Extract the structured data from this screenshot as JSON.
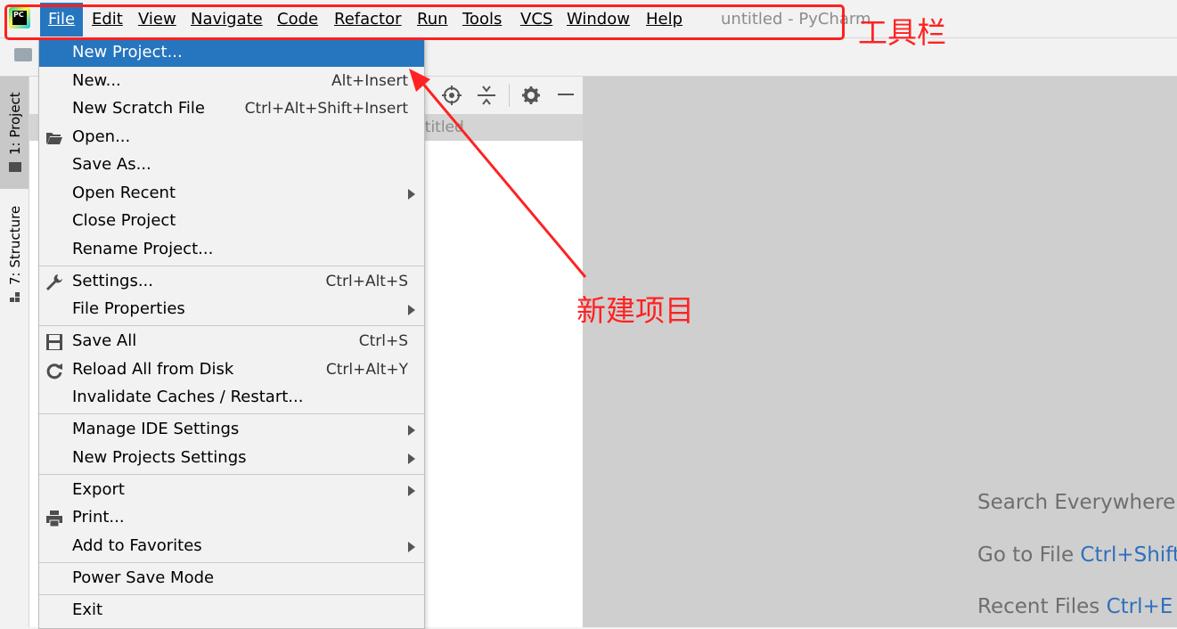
{
  "app": {
    "logo_text": "PC",
    "window_title": "untitled - PyCharm"
  },
  "menubar": {
    "items": [
      {
        "label": "File",
        "underline": 0
      },
      {
        "label": "Edit",
        "underline": 0
      },
      {
        "label": "View",
        "underline": 0
      },
      {
        "label": "Navigate",
        "underline": 0
      },
      {
        "label": "Code",
        "underline": 0
      },
      {
        "label": "Refactor",
        "underline": 0
      },
      {
        "label": "Run",
        "underline": 0
      },
      {
        "label": "Tools",
        "underline": 0
      },
      {
        "label": "VCS",
        "underline": 0
      },
      {
        "label": "Window",
        "underline": 0
      },
      {
        "label": "Help",
        "underline": 0
      }
    ]
  },
  "annotations": {
    "toolbar_label": "工具栏",
    "new_project_label": "新建项目",
    "color": "#ff2222"
  },
  "left_strip": {
    "project_tab": "1: Project",
    "structure_tab": "7: Structure"
  },
  "project_pane": {
    "row_text": "ntitled"
  },
  "file_menu": {
    "items": [
      {
        "label": "New Project...",
        "shortcut": "",
        "submenu": false
      },
      {
        "label": "New...",
        "shortcut": "Alt+Insert",
        "submenu": false
      },
      {
        "label": "New Scratch File",
        "shortcut": "Ctrl+Alt+Shift+Insert",
        "submenu": false
      },
      {
        "label": "Open...",
        "shortcut": "",
        "submenu": false,
        "icon": "folder-open-icon"
      },
      {
        "label": "Save As...",
        "shortcut": "",
        "submenu": false
      },
      {
        "label": "Open Recent",
        "shortcut": "",
        "submenu": true
      },
      {
        "label": "Close Project",
        "shortcut": "",
        "submenu": false
      },
      {
        "label": "Rename Project...",
        "shortcut": "",
        "submenu": false
      },
      {
        "label": "Settings...",
        "shortcut": "Ctrl+Alt+S",
        "submenu": false,
        "icon": "wrench-icon"
      },
      {
        "label": "File Properties",
        "shortcut": "",
        "submenu": true
      },
      {
        "label": "Save All",
        "shortcut": "Ctrl+S",
        "submenu": false,
        "icon": "save-icon"
      },
      {
        "label": "Reload All from Disk",
        "shortcut": "Ctrl+Alt+Y",
        "submenu": false,
        "icon": "reload-icon"
      },
      {
        "label": "Invalidate Caches / Restart...",
        "shortcut": "",
        "submenu": false
      },
      {
        "label": "Manage IDE Settings",
        "shortcut": "",
        "submenu": true
      },
      {
        "label": "New Projects Settings",
        "shortcut": "",
        "submenu": true
      },
      {
        "label": "Export",
        "shortcut": "",
        "submenu": true
      },
      {
        "label": "Print...",
        "shortcut": "",
        "submenu": false,
        "icon": "printer-icon"
      },
      {
        "label": "Add to Favorites",
        "shortcut": "",
        "submenu": true
      },
      {
        "label": "Power Save Mode",
        "shortcut": "",
        "submenu": false
      },
      {
        "label": "Exit",
        "shortcut": "",
        "submenu": false
      }
    ]
  },
  "editor_hints": [
    {
      "text": "Search Everywhere",
      "shortcut": ""
    },
    {
      "text": "Go to File",
      "shortcut": "Ctrl+Shift"
    },
    {
      "text": "Recent Files",
      "shortcut": "Ctrl+E"
    }
  ],
  "colors": {
    "highlight": "#2675bf",
    "annotation": "#ff2222",
    "shortcut_link": "#2f6fbd"
  }
}
